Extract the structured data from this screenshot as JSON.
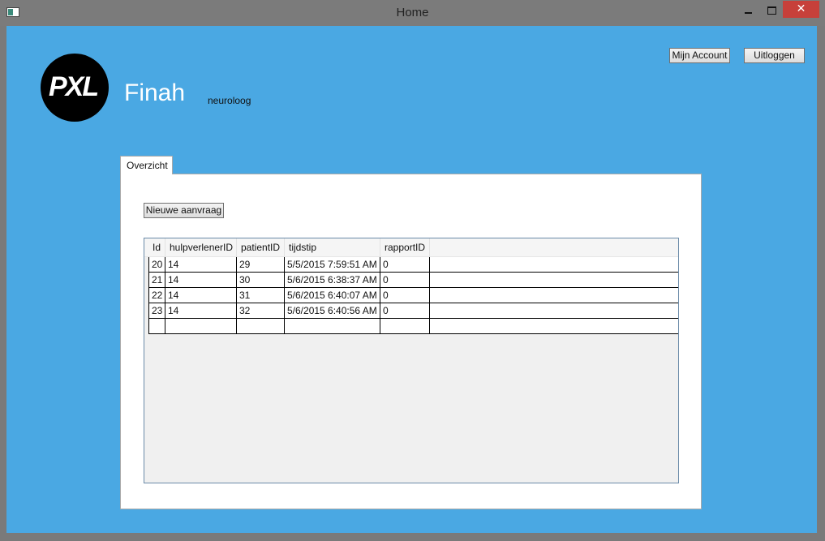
{
  "window": {
    "title": "Home",
    "close_glyph": "✕"
  },
  "header": {
    "logo_text": "PXL",
    "user_name": "Finah",
    "user_role": "neuroloog",
    "account_button": "Mijn Account",
    "logout_button": "Uitloggen"
  },
  "tabs": [
    {
      "label": "Overzicht"
    }
  ],
  "overview": {
    "new_request_button": "Nieuwe aanvraag",
    "grid": {
      "columns": [
        "Id",
        "hulpverlenerID",
        "patientID",
        "tijdstip",
        "rapportID"
      ],
      "rows": [
        [
          "20",
          "14",
          "29",
          "5/5/2015 7:59:51 AM",
          "0"
        ],
        [
          "21",
          "14",
          "30",
          "5/6/2015 6:38:37 AM",
          "0"
        ],
        [
          "22",
          "14",
          "31",
          "5/6/2015 6:40:07 AM",
          "0"
        ],
        [
          "23",
          "14",
          "32",
          "5/6/2015 6:40:56 AM",
          "0"
        ],
        [
          "",
          "",
          "",
          "",
          ""
        ]
      ]
    }
  }
}
